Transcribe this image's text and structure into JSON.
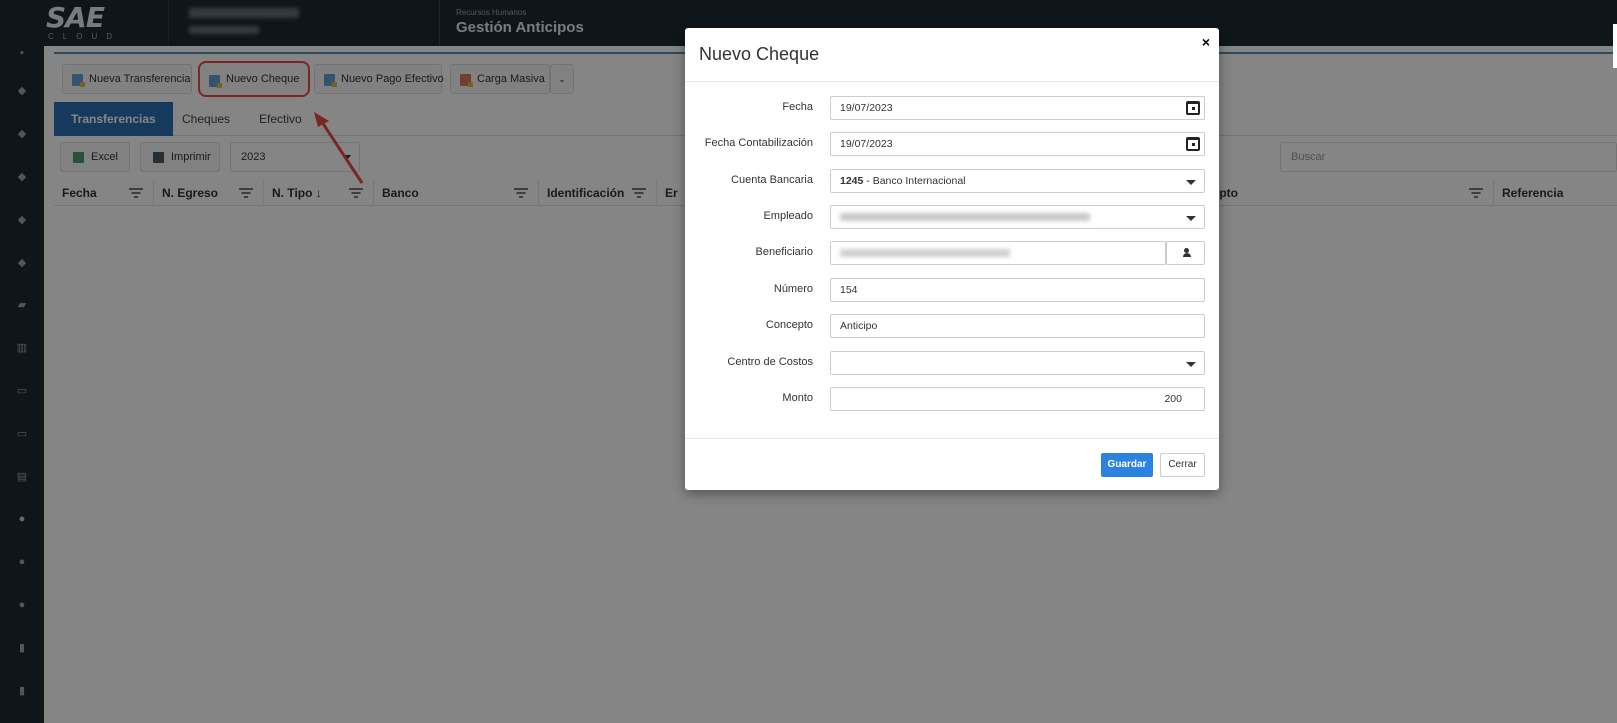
{
  "header": {
    "logo_main": "SAE",
    "logo_sub": "CLOUD",
    "module_sub": "Recursos Humanos",
    "module_title": "Gestión Anticipos"
  },
  "toolbar": {
    "nueva_transferencia": "Nueva Transferencia",
    "nuevo_cheque": "Nuevo Cheque",
    "nuevo_pago_efectivo": "Nuevo Pago Efectivo",
    "carga_masiva": "Carga Masiva"
  },
  "tabs": [
    {
      "label": "Transferencias",
      "active": true
    },
    {
      "label": "Cheques",
      "active": false
    },
    {
      "label": "Efectivo",
      "active": false
    }
  ],
  "subtoolbar": {
    "excel": "Excel",
    "imprimir": "Imprimir",
    "year": "2023",
    "search_placeholder": "Buscar"
  },
  "grid": {
    "columns": [
      "Fecha",
      "N. Egreso",
      "N. Tipo ↓",
      "Banco",
      "Identificación",
      "Er",
      "cepto",
      "Referencia"
    ]
  },
  "modal": {
    "title": "Nuevo Cheque",
    "close": "×",
    "fields": {
      "fecha": {
        "label": "Fecha",
        "value": "19/07/2023"
      },
      "fecha_contab": {
        "label": "Fecha Contabilización",
        "value": "19/07/2023"
      },
      "cuenta": {
        "label": "Cuenta Bancaria",
        "code": "1245",
        "value": " - Banco Internacional"
      },
      "empleado": {
        "label": "Empleado"
      },
      "beneficiario": {
        "label": "Beneficiario"
      },
      "numero": {
        "label": "Número",
        "value": "154"
      },
      "concepto": {
        "label": "Concepto",
        "value": "Anticipo"
      },
      "centro": {
        "label": "Centro de Costos",
        "value": ""
      },
      "monto": {
        "label": "Monto",
        "value": "200"
      }
    },
    "save": "Guardar",
    "cancel": "Cerrar"
  },
  "colors": {
    "topbar": "#1e2b33",
    "tab_active": "#2b6fb4",
    "highlight": "#e94b3c",
    "save_button": "#2b82e0"
  }
}
